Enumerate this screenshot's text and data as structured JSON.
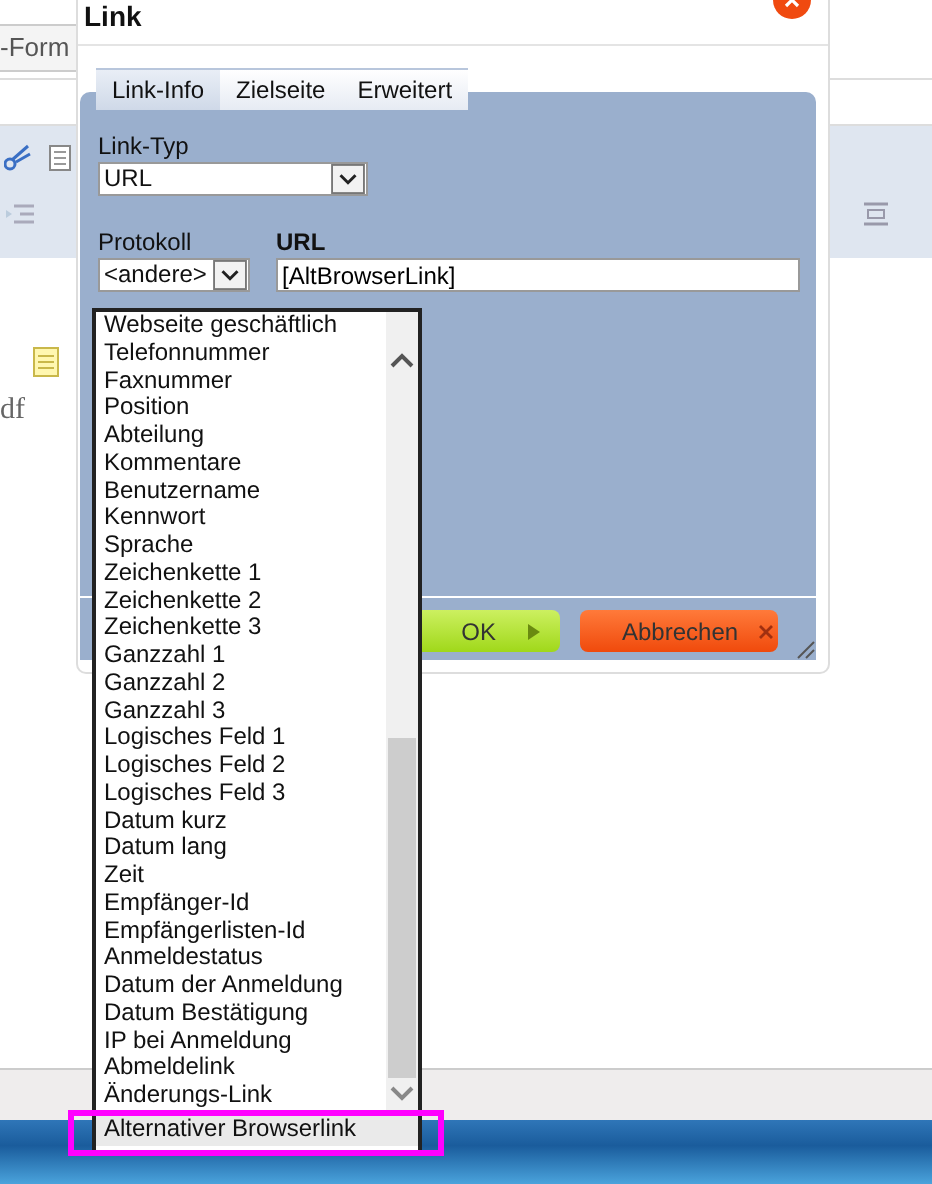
{
  "page": {
    "tab_text": "-Form",
    "body_text": "df"
  },
  "dialog": {
    "title": "Link",
    "tabs": [
      {
        "label": "Link-Info",
        "selected": true
      },
      {
        "label": "Zielseite",
        "selected": false
      },
      {
        "label": "Erweitert",
        "selected": false
      }
    ],
    "link_type": {
      "label": "Link-Typ",
      "value": "URL"
    },
    "protocol": {
      "label": "Protokoll",
      "value": "<andere>"
    },
    "url": {
      "label": "URL",
      "value": "[AltBrowserLink]"
    },
    "buttons": [
      {
        "label": "OK",
        "kind": "ok"
      },
      {
        "label": "Abbrechen",
        "kind": "cancel"
      }
    ]
  },
  "dropdown": {
    "items": [
      {
        "label": "Webseite geschäftlich",
        "selected": false
      },
      {
        "label": "Telefonnummer",
        "selected": false
      },
      {
        "label": "Faxnummer",
        "selected": false
      },
      {
        "label": "Position",
        "selected": false
      },
      {
        "label": "Abteilung",
        "selected": false
      },
      {
        "label": "Kommentare",
        "selected": false
      },
      {
        "label": "Benutzername",
        "selected": false
      },
      {
        "label": "Kennwort",
        "selected": false
      },
      {
        "label": "Sprache",
        "selected": false
      },
      {
        "label": "Zeichenkette 1",
        "selected": false
      },
      {
        "label": "Zeichenkette 2",
        "selected": false
      },
      {
        "label": "Zeichenkette 3",
        "selected": false
      },
      {
        "label": "Ganzzahl 1",
        "selected": false
      },
      {
        "label": "Ganzzahl 2",
        "selected": false
      },
      {
        "label": "Ganzzahl 3",
        "selected": false
      },
      {
        "label": "Logisches Feld 1",
        "selected": false
      },
      {
        "label": "Logisches Feld 2",
        "selected": false
      },
      {
        "label": "Logisches Feld 3",
        "selected": false
      },
      {
        "label": "Datum kurz",
        "selected": false
      },
      {
        "label": "Datum lang",
        "selected": false
      },
      {
        "label": "Zeit",
        "selected": false
      },
      {
        "label": "Empfänger-Id",
        "selected": false
      },
      {
        "label": "Empfängerlisten-Id",
        "selected": false
      },
      {
        "label": "Anmeldestatus",
        "selected": false
      },
      {
        "label": "Datum der Anmeldung",
        "selected": false
      },
      {
        "label": "Datum Bestätigung",
        "selected": false
      },
      {
        "label": "IP bei Anmeldung",
        "selected": false
      },
      {
        "label": "Abmeldelink",
        "selected": false
      },
      {
        "label": "Änderungs-Link",
        "selected": false
      },
      {
        "label": "Alternativer Browserlink",
        "selected": true
      }
    ]
  }
}
